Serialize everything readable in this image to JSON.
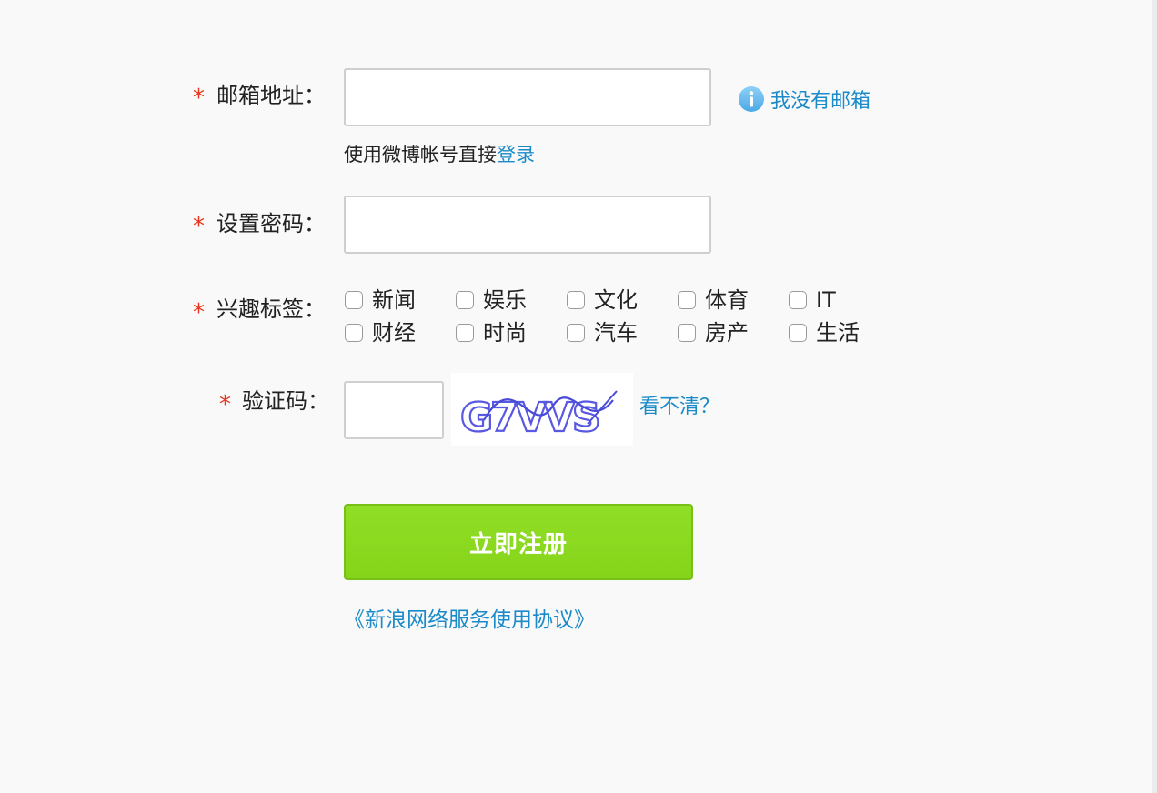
{
  "form": {
    "email": {
      "label": "邮箱地址：",
      "value": "",
      "no_email_link": "我没有邮箱",
      "hint_prefix": "使用微博帐号直接",
      "hint_link": "登录"
    },
    "password": {
      "label": "设置密码：",
      "value": ""
    },
    "interests": {
      "label": "兴趣标签：",
      "tags": [
        "新闻",
        "娱乐",
        "文化",
        "体育",
        "IT",
        "财经",
        "时尚",
        "汽车",
        "房产",
        "生活"
      ]
    },
    "captcha": {
      "label": "验证码：",
      "value": "",
      "image_text": "G7VVS",
      "refresh_link": "看不清？"
    },
    "required_mark": "*",
    "submit_label": "立即注册",
    "agreement_link": "《新浪网络服务使用协议》"
  },
  "colors": {
    "background": "#f9f9f9",
    "required": "#e8341c",
    "link": "#1a8ac9",
    "button": "#88d41c",
    "captcha_ink": "#5a5ae0"
  },
  "icons": {
    "info": "info-circle-icon"
  }
}
